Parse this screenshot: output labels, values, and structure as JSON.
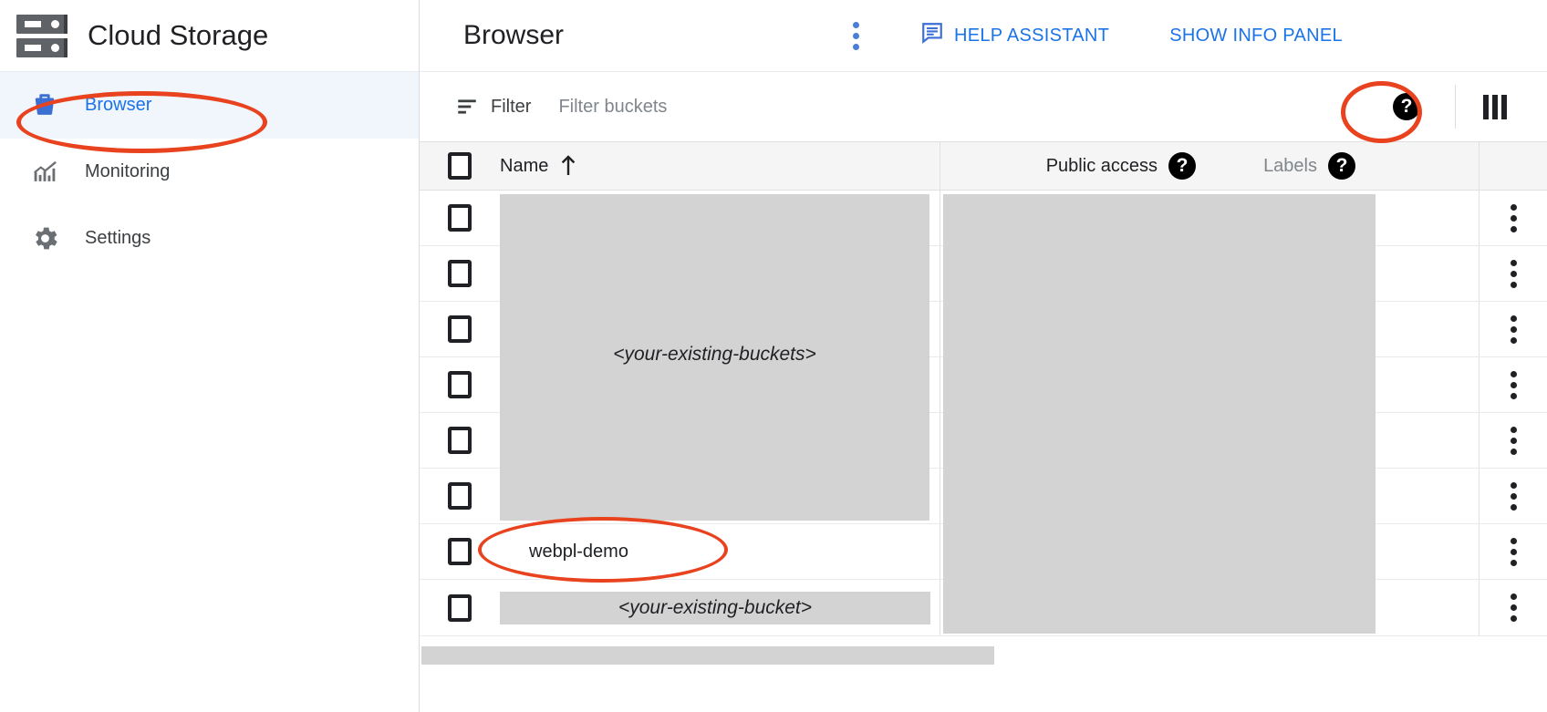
{
  "sidebar": {
    "brand": {
      "title": "Cloud Storage",
      "logo_icon": "server-racks-icon"
    },
    "items": [
      {
        "label": "Browser",
        "icon": "bucket-icon",
        "active": true
      },
      {
        "label": "Monitoring",
        "icon": "chart-line-icon",
        "active": false
      },
      {
        "label": "Settings",
        "icon": "gear-icon",
        "active": false
      }
    ]
  },
  "header": {
    "title": "Browser",
    "overflow_menu_icon": "kebab-menu-icon",
    "help_assistant_label": "HELP ASSISTANT",
    "help_assistant_icon": "chat-bubble-icon",
    "show_info_panel_label": "SHOW INFO PANEL"
  },
  "filter_bar": {
    "filter_icon": "filter-icon",
    "filter_label": "Filter",
    "filter_placeholder": "Filter buckets",
    "filter_value": "",
    "help_icon": "help-circle-icon",
    "columns_icon": "columns-icon"
  },
  "table": {
    "columns": {
      "select_all": "",
      "name": "Name",
      "name_sort_icon": "sort-ascending-arrow-icon",
      "public_access": "Public access",
      "public_access_help_icon": "help-circle-icon",
      "labels": "Labels",
      "labels_help_icon": "help-circle-icon"
    },
    "redacted_group_label": "<your-existing-buckets>",
    "rows": [
      {
        "name": "",
        "redacted": true
      },
      {
        "name": "",
        "redacted": true
      },
      {
        "name": "",
        "redacted": true
      },
      {
        "name": "",
        "redacted": true
      },
      {
        "name": "",
        "redacted": true
      },
      {
        "name": "",
        "redacted": true
      },
      {
        "name": "webpl-demo",
        "redacted": false
      },
      {
        "name": "<your-existing-bucket>",
        "redacted": true
      }
    ],
    "row_menu_icon": "kebab-menu-icon"
  },
  "annotations": {
    "colors": {
      "highlight": "#e8421e",
      "accent": "#1a73e8",
      "redaction": "#d3d3d3"
    },
    "ellipses": [
      {
        "target": "sidebar-item-browser"
      },
      {
        "target": "columns-button"
      },
      {
        "target": "row-webpl-demo"
      }
    ]
  }
}
